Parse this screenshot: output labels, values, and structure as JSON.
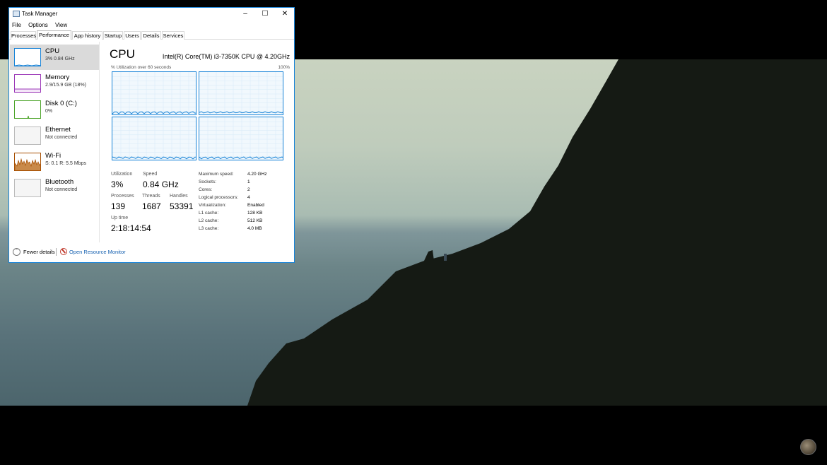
{
  "window": {
    "title": "Task Manager",
    "menu": [
      "File",
      "Options",
      "View"
    ],
    "tabs": [
      "Processes",
      "Performance",
      "App history",
      "Startup",
      "Users",
      "Details",
      "Services"
    ],
    "active_tab": "Performance"
  },
  "sidebar": {
    "items": [
      {
        "name": "CPU",
        "sub": "3%  0.84 GHz",
        "color": "#1883d7",
        "active": true
      },
      {
        "name": "Memory",
        "sub": "2.9/15.9 GB (18%)",
        "color": "#9b36b7"
      },
      {
        "name": "Disk 0 (C:)",
        "sub": "0%",
        "color": "#4ca428"
      },
      {
        "name": "Ethernet",
        "sub": "Not connected",
        "color": "#aaaaaa"
      },
      {
        "name": "Wi-Fi",
        "sub": "S: 0.1  R: 5.5 Mbps",
        "color": "#a74f01"
      },
      {
        "name": "Bluetooth",
        "sub": "Not connected",
        "color": "#aaaaaa"
      }
    ]
  },
  "cpu": {
    "title": "CPU",
    "model": "Intel(R) Core(TM) i3-7350K CPU @ 4.20GHz",
    "graph_label": "% Utilization over 60 seconds",
    "graph_max": "100%",
    "stats": {
      "utilization_label": "Utilization",
      "utilization": "3%",
      "speed_label": "Speed",
      "speed": "0.84 GHz",
      "processes_label": "Processes",
      "processes": "139",
      "threads_label": "Threads",
      "threads": "1687",
      "handles_label": "Handles",
      "handles": "53391",
      "uptime_label": "Up time",
      "uptime": "2:18:14:54"
    },
    "specs": [
      {
        "label": "Maximum speed:",
        "value": "4.20 GHz"
      },
      {
        "label": "Sockets:",
        "value": "1"
      },
      {
        "label": "Cores:",
        "value": "2"
      },
      {
        "label": "Logical processors:",
        "value": "4"
      },
      {
        "label": "Virtualization:",
        "value": "Enabled"
      },
      {
        "label": "L1 cache:",
        "value": "128 KB"
      },
      {
        "label": "L2 cache:",
        "value": "512 KB"
      },
      {
        "label": "L3 cache:",
        "value": "4.0 MB"
      }
    ]
  },
  "footer": {
    "fewer_details": "Fewer details",
    "resource_monitor": "Open Resource Monitor"
  },
  "colors": {
    "accent": "#1883d7",
    "link": "#1560b0"
  }
}
